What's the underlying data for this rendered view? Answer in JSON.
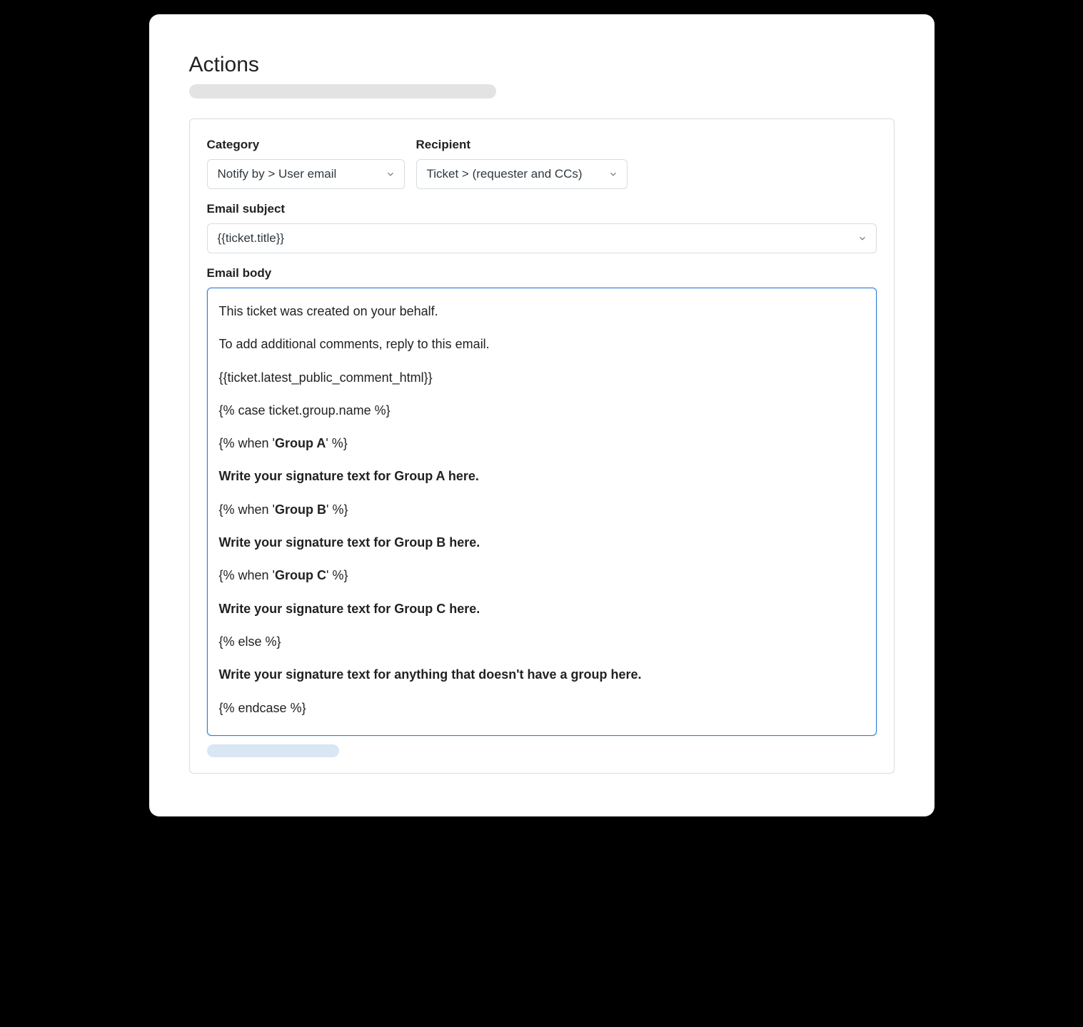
{
  "page": {
    "title": "Actions"
  },
  "labels": {
    "category": "Category",
    "recipient": "Recipient",
    "email_subject": "Email subject",
    "email_body": "Email body"
  },
  "category": {
    "selected": "Notify by > User email"
  },
  "recipient": {
    "selected": "Ticket > (requester and CCs)"
  },
  "email_subject": {
    "value": "{{ticket.title}}"
  },
  "email_body": {
    "lines": [
      {
        "text": "This ticket was created on your behalf."
      },
      {
        "text": "To add additional comments, reply to this email."
      },
      {
        "text": "{{ticket.latest_public_comment_html}}"
      },
      {
        "text": "{% case ticket.group.name %}"
      },
      {
        "prefix": "{% when '",
        "bold": "Group A",
        "suffix": "' %}"
      },
      {
        "bold": "Write your signature text for Group A here."
      },
      {
        "prefix": "{% when '",
        "bold": "Group B",
        "suffix": "' %}"
      },
      {
        "bold": "Write your signature text for Group B here."
      },
      {
        "prefix": "{% when '",
        "bold": "Group C",
        "suffix": "' %}"
      },
      {
        "bold": "Write your signature text for Group C here."
      },
      {
        "text": "{% else %}"
      },
      {
        "bold": "Write your signature text for anything that doesn't have a group here."
      },
      {
        "text": "{% endcase %}"
      }
    ]
  }
}
